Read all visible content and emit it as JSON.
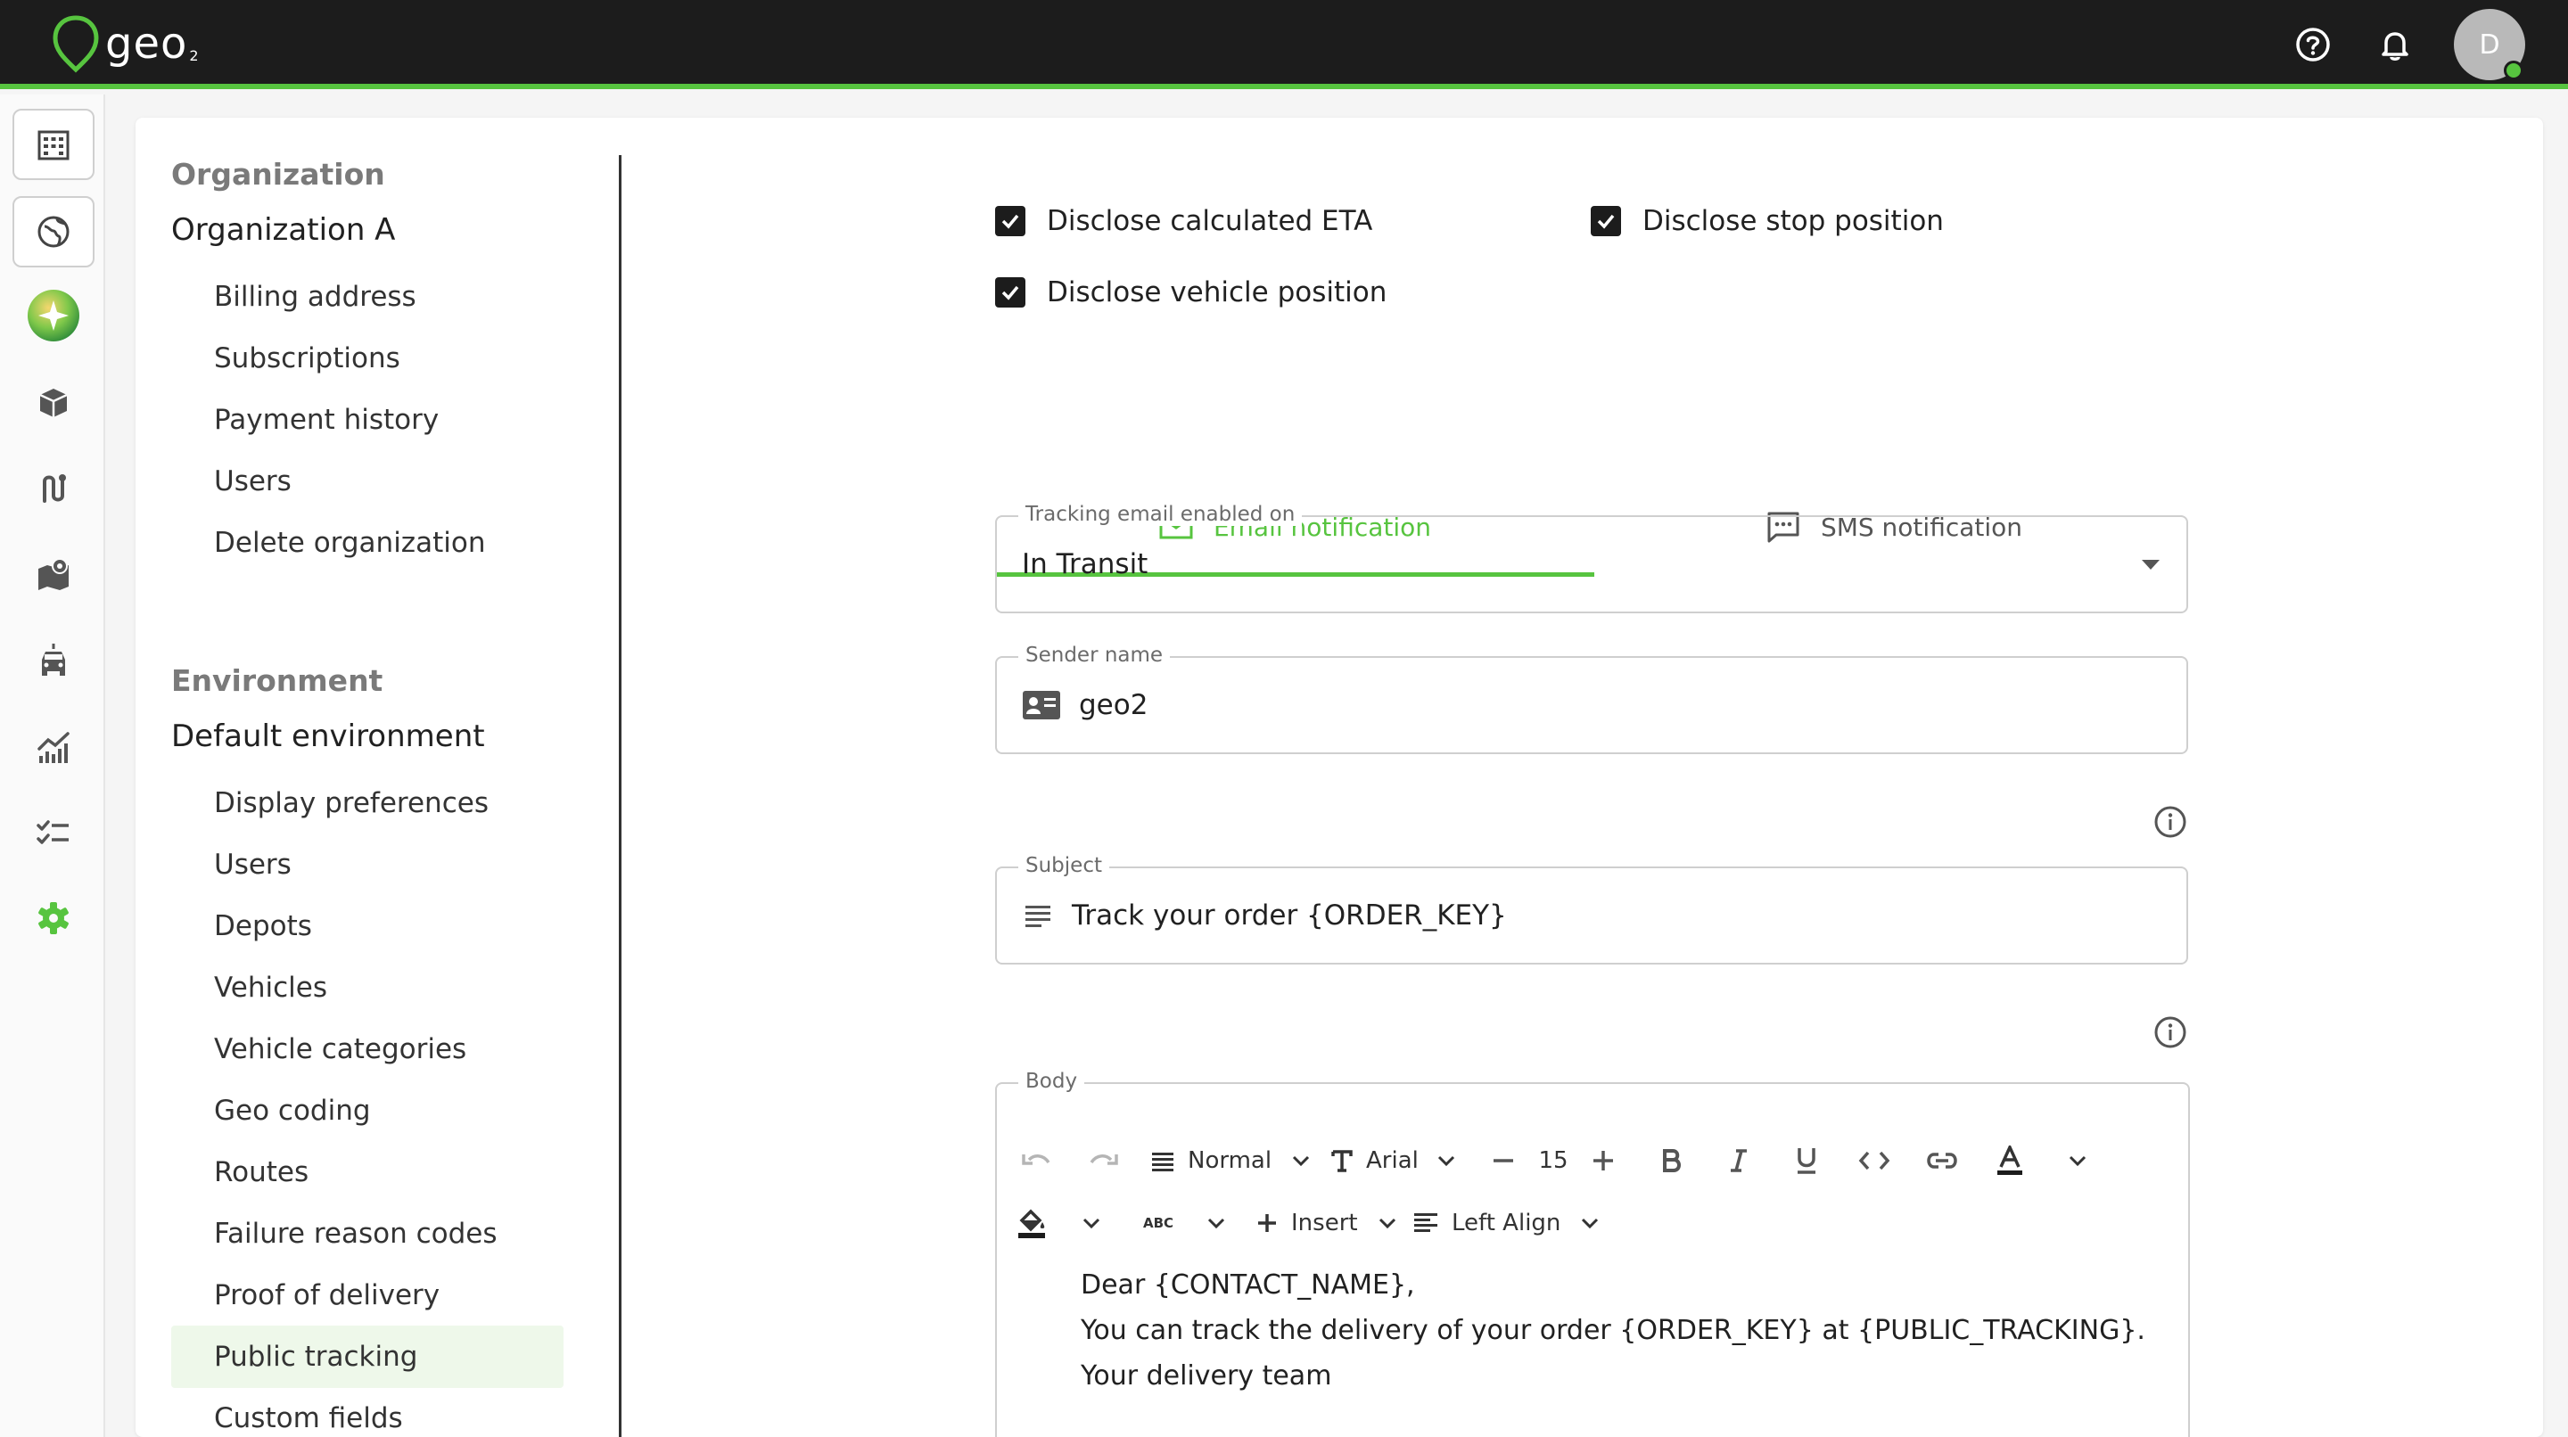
{
  "app": {
    "brand": "geo",
    "brand_sub": "2",
    "avatar_initial": "D",
    "accent_color": "#57c43f",
    "topbar_color": "#1c1c1c"
  },
  "topbar": {
    "help_icon": "help-circle-icon",
    "notifications_icon": "bell-icon"
  },
  "rail": {
    "items": [
      {
        "icon": "building-icon"
      },
      {
        "icon": "globe-icon"
      },
      {
        "icon": "sparkle-orb-icon"
      },
      {
        "icon": "package-icon"
      },
      {
        "icon": "route-icon"
      },
      {
        "icon": "map-icon"
      },
      {
        "icon": "vehicle-icon"
      },
      {
        "icon": "analytics-icon"
      },
      {
        "icon": "checklist-icon"
      },
      {
        "icon": "settings-icon"
      }
    ]
  },
  "subnav": {
    "org_heading": "Organization",
    "org_name": "Organization A",
    "org_items": [
      "Billing address",
      "Subscriptions",
      "Payment history",
      "Users",
      "Delete organization"
    ],
    "env_heading": "Environment",
    "env_name": "Default environment",
    "env_items": [
      "Display preferences",
      "Users",
      "Depots",
      "Vehicles",
      "Vehicle categories",
      "Geo coding",
      "Routes",
      "Failure reason codes",
      "Proof of delivery",
      "Public tracking",
      "Custom fields"
    ],
    "active_item": "Public tracking"
  },
  "settings": {
    "disclose_eta": {
      "label": "Disclose calculated ETA",
      "checked": true
    },
    "disclose_stop": {
      "label": "Disclose stop position",
      "checked": true
    },
    "disclose_vehicle": {
      "label": "Disclose vehicle position",
      "checked": true
    }
  },
  "tabs": {
    "email": {
      "label": "Email notification",
      "icon": "mail-icon",
      "active": true
    },
    "sms": {
      "label": "SMS notification",
      "icon": "chat-icon",
      "active": false
    }
  },
  "form": {
    "tracking": {
      "label": "Tracking email enabled on",
      "value": "In Transit"
    },
    "sender": {
      "label": "Sender name",
      "value": "geo2",
      "icon": "contact-card-icon"
    },
    "subject": {
      "label": "Subject",
      "value": "Track your order {ORDER_KEY}",
      "icon": "text-lines-icon"
    },
    "body": {
      "label": "Body"
    }
  },
  "editor": {
    "paragraph_style": "Normal",
    "font": "Arial",
    "font_size": "15",
    "insert_label": "Insert",
    "align_label": "Left Align",
    "spellcheck_label": "ABC",
    "lines": [
      "Dear {CONTACT_NAME},",
      "You can track the delivery of your order {ORDER_KEY} at {PUBLIC_TRACKING}.",
      "Your delivery team"
    ]
  }
}
